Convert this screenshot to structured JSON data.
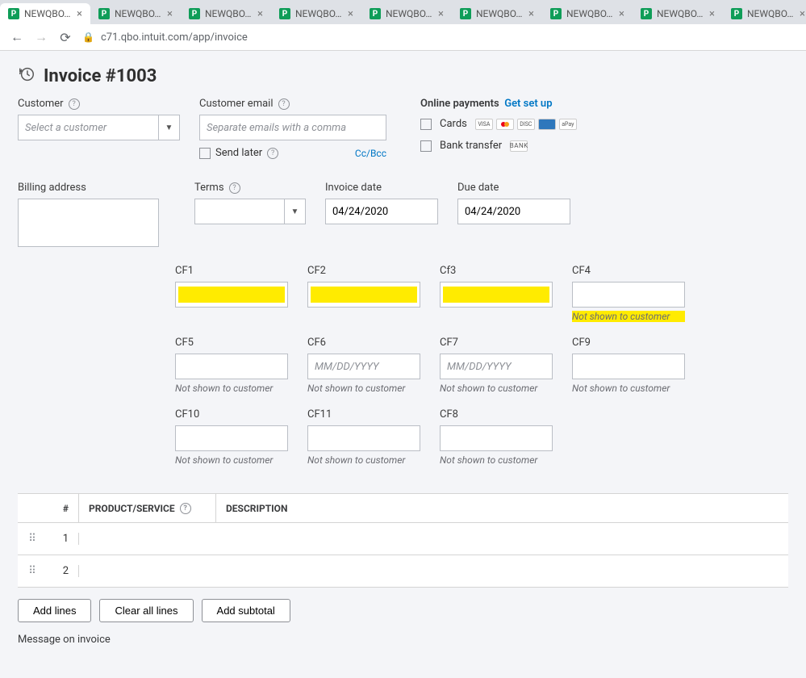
{
  "browser": {
    "tabs": [
      {
        "title": "NEWQBO.CO"
      },
      {
        "title": "NEWQBO.CO"
      },
      {
        "title": "NEWQBO.CO"
      },
      {
        "title": "NEWQBO.CO"
      },
      {
        "title": "NEWQBO.CO"
      },
      {
        "title": "NEWQBO.CO"
      },
      {
        "title": "NEWQBO.CO"
      },
      {
        "title": "NEWQBO.CO"
      },
      {
        "title": "NEWQBO.CO"
      }
    ],
    "url": "c71.qbo.intuit.com/app/invoice"
  },
  "header": {
    "title": "Invoice #1003"
  },
  "customer": {
    "label": "Customer",
    "placeholder": "Select a customer",
    "email_label": "Customer email",
    "email_placeholder": "Separate emails with a comma",
    "send_later": "Send later",
    "ccbcc": "Cc/Bcc"
  },
  "payments": {
    "title": "Online payments",
    "setup": "Get set up",
    "cards": "Cards",
    "bank": "Bank transfer",
    "card_icons": [
      "VISA",
      "MC",
      "DISC",
      "AMEX",
      "aPay"
    ],
    "bank_icon": "BANK"
  },
  "terms": {
    "label": "Terms"
  },
  "billing": {
    "label": "Billing address"
  },
  "invoice_date": {
    "label": "Invoice date",
    "value": "04/24/2020"
  },
  "due_date": {
    "label": "Due date",
    "value": "04/24/2020"
  },
  "cf": {
    "note": "Not shown to customer",
    "date_placeholder": "MM/DD/YYYY",
    "f1": {
      "label": "CF1"
    },
    "f2": {
      "label": "CF2"
    },
    "f3": {
      "label": "Cf3"
    },
    "f4": {
      "label": "CF4"
    },
    "f5": {
      "label": "CF5"
    },
    "f6": {
      "label": "CF6"
    },
    "f7": {
      "label": "CF7"
    },
    "f9": {
      "label": "CF9"
    },
    "f10": {
      "label": "CF10"
    },
    "f11": {
      "label": "CF11"
    },
    "f8": {
      "label": "CF8"
    }
  },
  "table": {
    "h_num": "#",
    "h_prod": "PRODUCT/SERVICE",
    "h_desc": "DESCRIPTION",
    "rows": [
      {
        "n": "1"
      },
      {
        "n": "2"
      }
    ]
  },
  "buttons": {
    "add_lines": "Add lines",
    "clear_all": "Clear all lines",
    "add_subtotal": "Add subtotal"
  },
  "message_label": "Message on invoice"
}
